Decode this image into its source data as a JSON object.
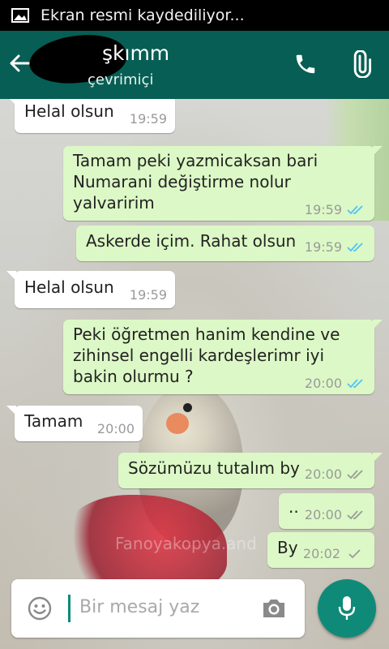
{
  "status_bar": {
    "notification": "Ekran resmi kaydediliyor..."
  },
  "header": {
    "contact_name": "şkımm",
    "presence": "çevrimiçi"
  },
  "messages": [
    {
      "direction": "in",
      "lines": [
        "Helal olsun"
      ],
      "time": "19:59"
    },
    {
      "direction": "out",
      "lines": [
        "Tamam peki yazmicaksan bari",
        "Numarani değiştirme nolur",
        "yalvaririm"
      ],
      "time": "19:59",
      "status": "read"
    },
    {
      "direction": "out",
      "lines": [
        "Askerde içim. Rahat olsun"
      ],
      "time": "19:59",
      "status": "read"
    },
    {
      "direction": "in",
      "lines": [
        "Helal olsun"
      ],
      "time": "19:59"
    },
    {
      "direction": "out",
      "lines": [
        "Peki öğretmen hanim kendine ve",
        "zihinsel engelli kardeşlerimr iyi",
        "bakin olurmu ?"
      ],
      "time": "20:00",
      "status": "read"
    },
    {
      "direction": "in",
      "lines": [
        "Tamam"
      ],
      "time": "20:00"
    },
    {
      "direction": "out",
      "lines": [
        "Sözümüzu tutalım by"
      ],
      "time": "20:00",
      "status": "delivered"
    },
    {
      "direction": "out",
      "lines": [
        ".."
      ],
      "time": "20:00",
      "status": "delivered"
    },
    {
      "direction": "out",
      "lines": [
        "By"
      ],
      "time": "20:02",
      "status": "sent"
    }
  ],
  "watermark": "Fanoyakopya.and",
  "composer": {
    "placeholder": "Bir mesaj yaz"
  },
  "colors": {
    "header": "#075e54",
    "outgoing_bubble": "#dcf8c6",
    "incoming_bubble": "#ffffff",
    "read_tick": "#4fc3f7",
    "mic_button": "#0f8a78"
  },
  "icons": {
    "back": "arrow-left-icon",
    "call": "phone-icon",
    "attach": "paperclip-icon",
    "emoji": "smiley-icon",
    "camera": "camera-icon",
    "mic": "mic-icon"
  }
}
